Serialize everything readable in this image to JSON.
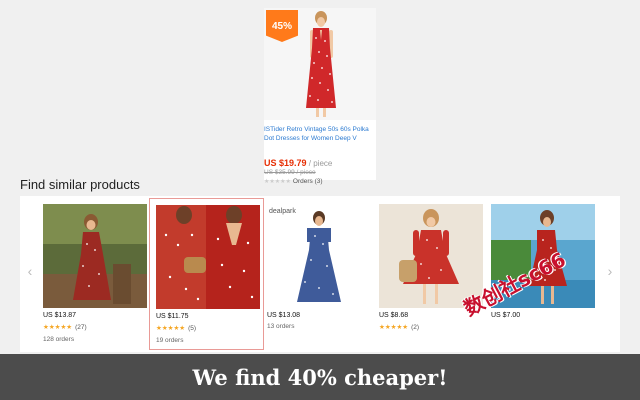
{
  "main_product": {
    "discount_badge": "45%",
    "title": "ISTider Retro Vintage 50s 60s Polka Dot Dresses for Women Deep V",
    "price": "US $19.79",
    "price_unit": "/ piece",
    "original_price": "US $35.99 / piece",
    "orders": "Orders (3)",
    "image_icon": "dress-photo",
    "dress_color": "#d0282a"
  },
  "section": {
    "title": "Find similar products"
  },
  "carousel": {
    "prev_icon": "chevron-left-icon",
    "next_icon": "chevron-right-icon",
    "items": [
      {
        "price": "US $13.87",
        "stars": "★★★★★",
        "reviews": "(27)",
        "orders": "128 orders",
        "dress_color": "#9c2a22",
        "bg_color": "#5c6b3a"
      },
      {
        "price": "US $11.75",
        "stars": "★★★★★",
        "reviews": "(5)",
        "orders": "19 orders",
        "dress_color": "#b5231c",
        "bg_color": "#c23b2c",
        "selected": true
      },
      {
        "price": "US $13.08",
        "stars": "",
        "reviews": "",
        "orders": "13 orders",
        "dress_color": "#3f5b9a",
        "bg_color": "#ffffff",
        "brand": "dealpark"
      },
      {
        "price": "US $8.68",
        "stars": "★★★★★",
        "reviews": "(2)",
        "orders": "",
        "dress_color": "#c9322a",
        "bg_color": "#ece4d8"
      },
      {
        "price": "US $7.00",
        "stars": "",
        "reviews": "",
        "orders": "",
        "dress_color": "#b8241e",
        "bg_color": "#5aa6cf"
      }
    ]
  },
  "banner": {
    "text": "We find 40% cheaper!"
  },
  "watermark": {
    "text": "数创社sc66"
  },
  "colors": {
    "accent_price": "#e62e04",
    "link": "#2b7ad1",
    "badge": "#ff7a1a",
    "star": "#f5a623",
    "banner_bg": "#4c4c4c"
  }
}
